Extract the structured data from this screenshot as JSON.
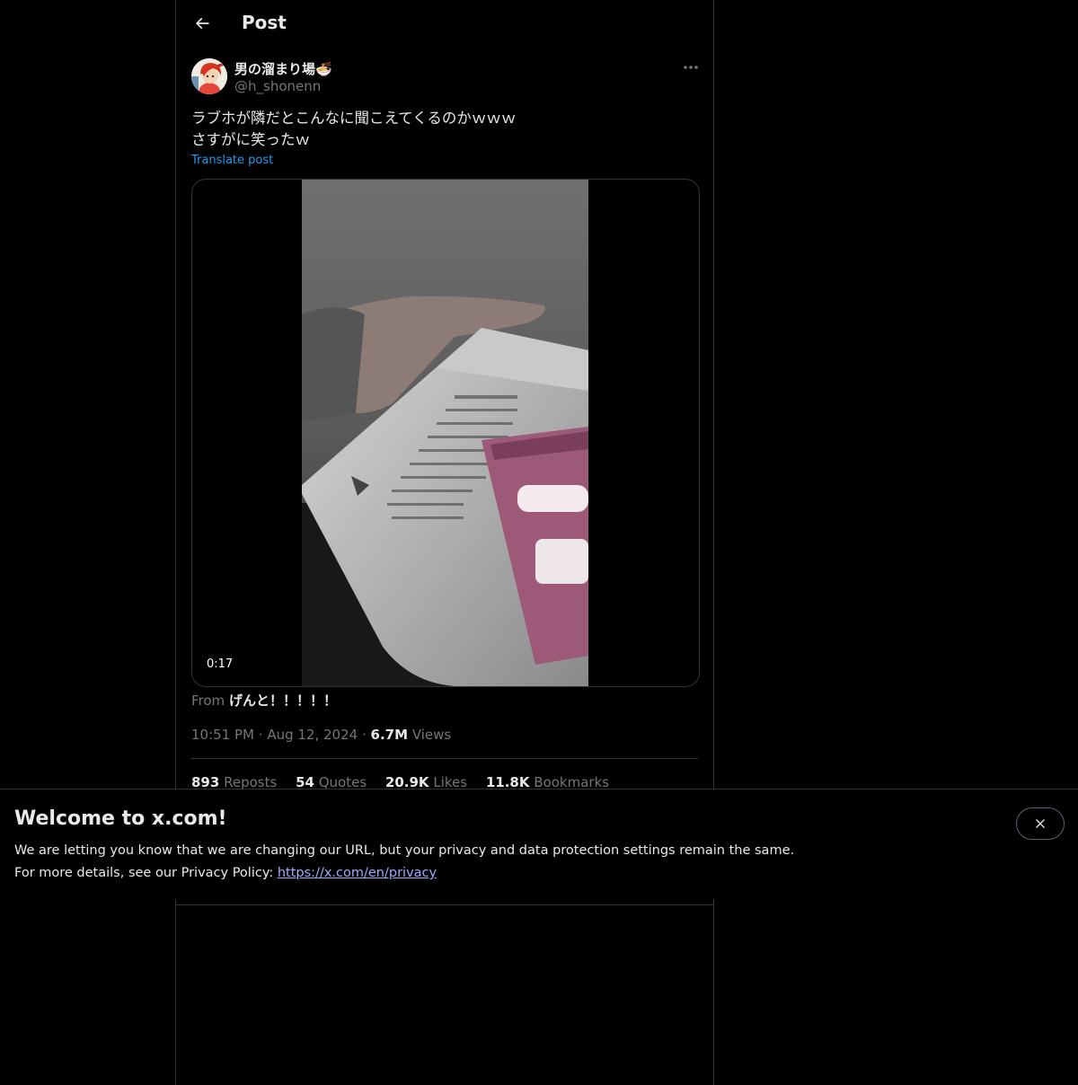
{
  "header": {
    "title": "Post"
  },
  "post": {
    "author_name": "男の溜まり場🍜",
    "author_handle": "@h_shonenn",
    "text_lines": [
      "ラブホが隣だとこんなに聞こえてくるのかｗｗｗ",
      "さすがに笑ったｗ"
    ],
    "translate_label": "Translate post",
    "video_duration": "0:17",
    "from_label": "From",
    "from_source": "げんと！！！！！",
    "time": "10:51 PM",
    "date": "Aug 12, 2024",
    "views_count": "6.7M",
    "views_label": "Views",
    "separator": "·"
  },
  "stats": {
    "reposts_count": "893",
    "reposts_label": "Reposts",
    "quotes_count": "54",
    "quotes_label": "Quotes",
    "likes_count": "20.9K",
    "likes_label": "Likes",
    "bookmarks_count": "11.8K",
    "bookmarks_label": "Bookmarks"
  },
  "banner": {
    "title": "Welcome to x.com!",
    "line1": "We are letting you know that we are changing our URL, but your privacy and data protection settings remain the same.",
    "line2_prefix": "For more details, see our Privacy Policy:",
    "link_text": "https://x.com/en/privacy"
  },
  "icons": {
    "back": "arrow-left-icon",
    "more": "more-horizontal-icon",
    "close": "close-icon"
  },
  "colors": {
    "background": "#000000",
    "text": "#e7e9ea",
    "muted": "#71767b",
    "link": "#1d9bf0",
    "banner_link": "#a3a8ff",
    "border": "#2f3336"
  }
}
